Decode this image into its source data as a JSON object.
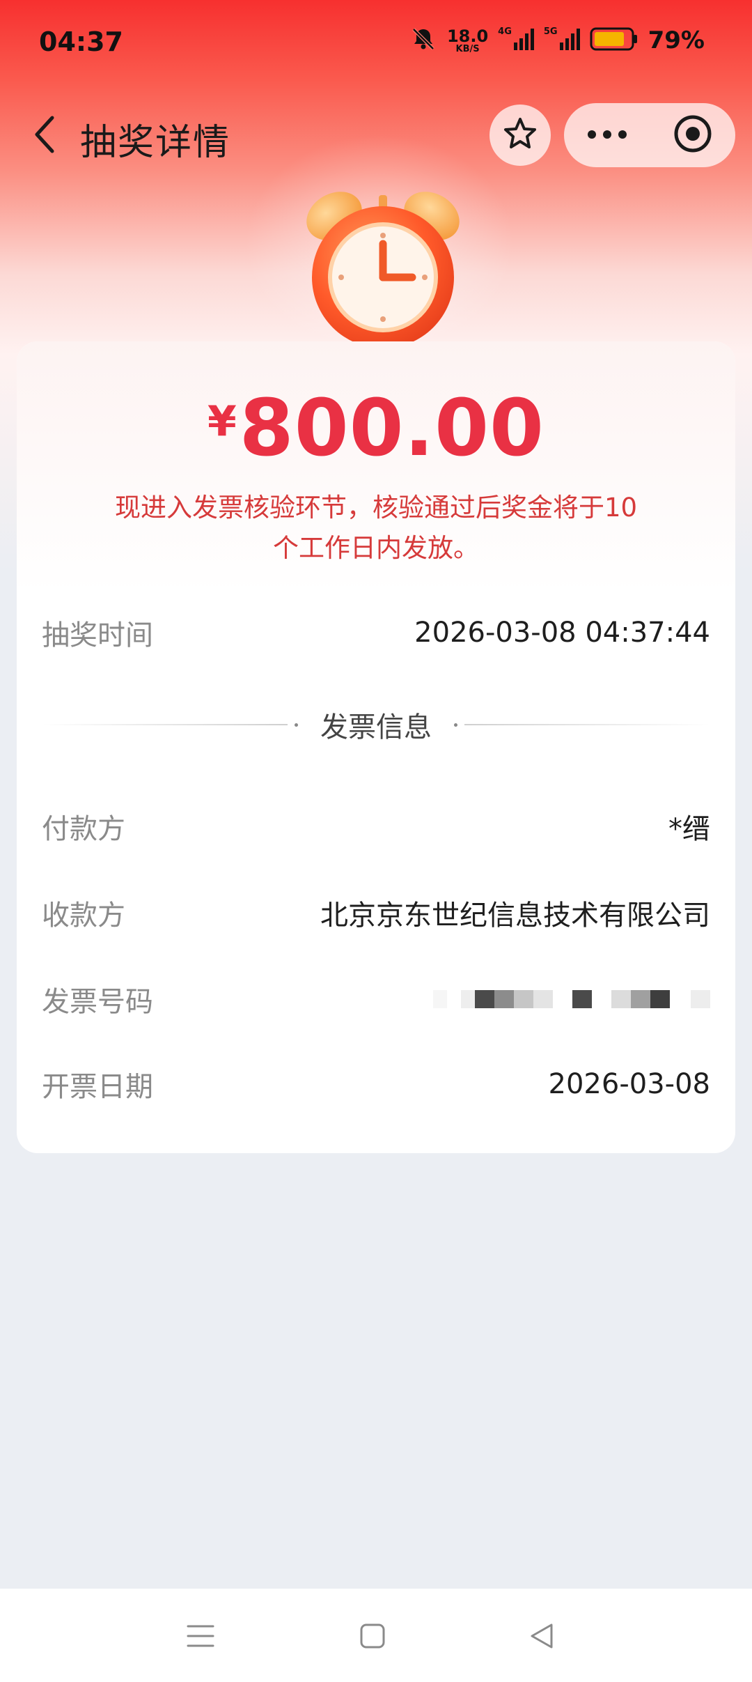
{
  "status_bar": {
    "time": "04:37",
    "speed_value": "18.0",
    "speed_unit": "KB/S",
    "net_4g": "4G",
    "net_5g": "5G",
    "battery_percent": "79%",
    "icons": [
      "mute-bell-icon",
      "signal-4g-icon",
      "signal-5g-icon",
      "battery-icon"
    ]
  },
  "header": {
    "title": "抽奖详情",
    "back_icon": "chevron-left-icon",
    "star_icon": "star-outline-icon",
    "more_icon": "more-dots-icon",
    "close_icon": "target-circle-icon"
  },
  "prize": {
    "currency": "¥",
    "amount": "800.00",
    "notice_line1": "现进入发票核验环节，核验通过后奖金将于10",
    "notice_line2": "个工作日内发放。"
  },
  "draw_time": {
    "label": "抽奖时间",
    "value": "2026-03-08 04:37:44"
  },
  "invoice_section": {
    "title": "发票信息",
    "payer_label": "付款方",
    "payer_value": "*缙",
    "payee_label": "收款方",
    "payee_value": "北京京东世纪信息技术有限公司",
    "number_label": "发票号码",
    "date_label": "开票日期",
    "date_value": "2026-03-08"
  },
  "colors": {
    "accent_red": "#e93144",
    "notice_red": "#d63a3a",
    "header_red": "#f7302f",
    "page_bg": "#ebeef3"
  },
  "nav_bar": {
    "icons": [
      "menu-lines-icon",
      "home-square-icon",
      "back-triangle-icon"
    ]
  }
}
